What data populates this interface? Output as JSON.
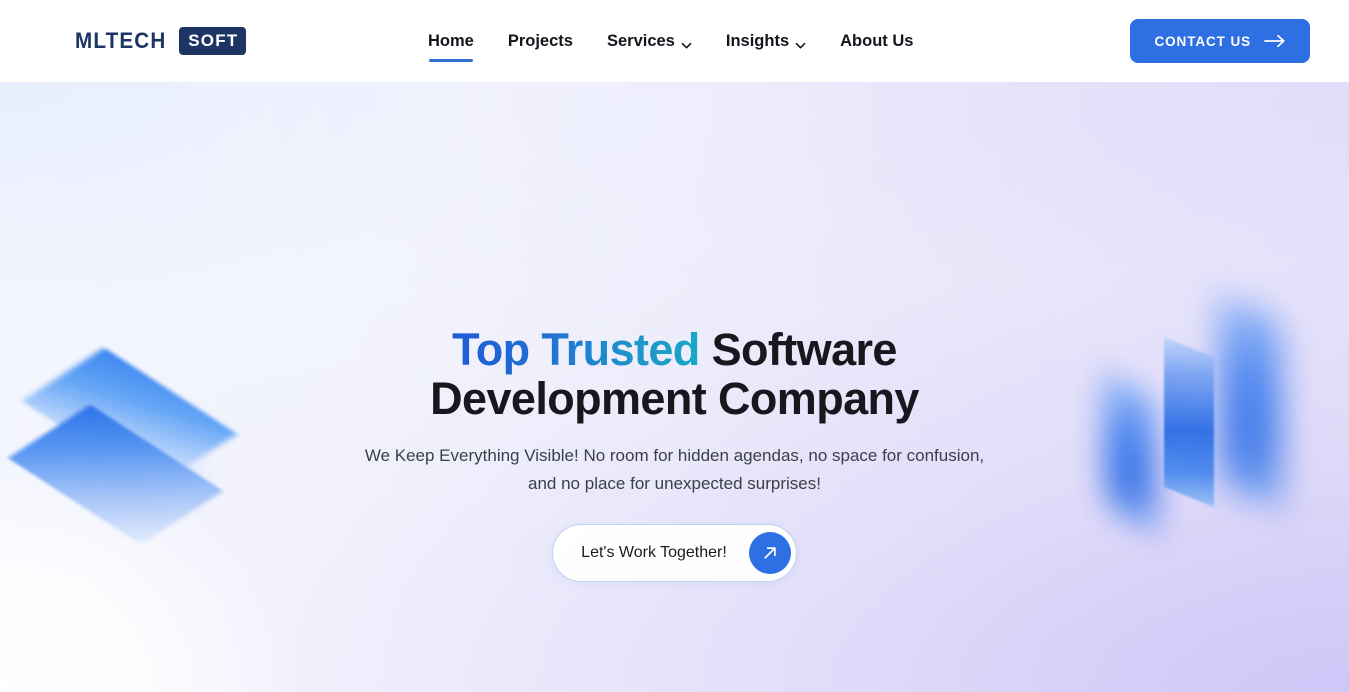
{
  "brand": {
    "name_primary": "MLTECH",
    "name_badge": "SOFT",
    "navy": "#1c3565",
    "accent_blue": "#2e6fe3"
  },
  "header": {
    "nav": [
      {
        "label": "Home",
        "active": true,
        "has_chevron": false
      },
      {
        "label": "Projects",
        "active": false,
        "has_chevron": false
      },
      {
        "label": "Services",
        "active": false,
        "has_chevron": true
      },
      {
        "label": "Insights",
        "active": false,
        "has_chevron": true
      },
      {
        "label": "About Us",
        "active": false,
        "has_chevron": false
      }
    ],
    "contact_button": {
      "label": "CONTACT US",
      "icon": "arrow-right-icon"
    }
  },
  "hero": {
    "headline_highlight": "Top Trusted",
    "headline_rest": " Software Development Company",
    "headline_full": "Top Trusted Software Development Company",
    "subheadline": "We Keep Everything Visible! No room for hidden agendas, no space for confusion, and no place for unexpected surprises!",
    "cta": {
      "label": "Let's Work Together!",
      "icon": "arrow-up-right-icon"
    },
    "highlight_gradient_from": "#1d5bd6",
    "highlight_gradient_to": "#18a8c6",
    "background_gradient_from": "#f4f6fe",
    "background_gradient_to": "#ded8f7"
  },
  "decorations": {
    "left": "stacked-isometric-plates",
    "right": "floating-parallelograms"
  }
}
